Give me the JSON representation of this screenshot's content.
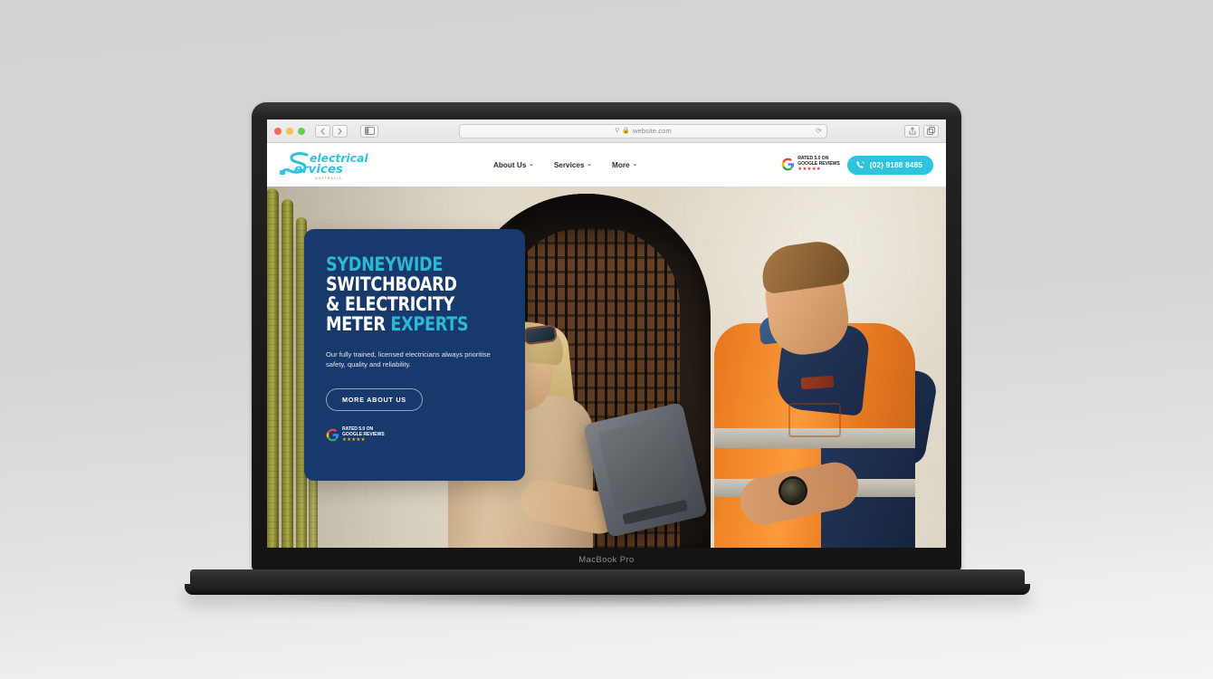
{
  "device": {
    "label": "MacBook Pro"
  },
  "browser": {
    "traffic_lights": [
      "close",
      "minimize",
      "maximize"
    ],
    "back_icon": "chevron-left-icon",
    "forward_icon": "chevron-right-icon",
    "sidebar_icon": "sidebar-toggle-icon",
    "search_icon": "search-icon",
    "lock_icon": "lock-icon",
    "url": "website.com",
    "reload_icon": "reload-icon",
    "share_icon": "share-icon",
    "tabs_icon": "tabs-icon"
  },
  "site": {
    "logo": {
      "word_a": "electrical",
      "word_b": "ervices",
      "initial": "S",
      "sub": "AUSTRALIA"
    },
    "nav": [
      {
        "label": "About Us",
        "caret": "⌄"
      },
      {
        "label": "Services",
        "caret": "⌄"
      },
      {
        "label": "More",
        "caret": "⌄"
      }
    ],
    "google_badge": {
      "line1": "RATED 5.0 ON",
      "line2": "GOOGLE REVIEWS",
      "stars": "★★★★★",
      "stars_color_header": "#e2342b",
      "stars_color_hero": "#f2b01e",
      "logo": "google-g-icon"
    },
    "phone": {
      "icon": "phone-icon",
      "number": "(02) 9188 8485",
      "bg": "#2ec4dd"
    }
  },
  "hero": {
    "headline_line1": "SYDNEYWIDE",
    "headline_line2": "SWITCHBOARD",
    "headline_line3": "& ELECTRICITY",
    "headline_line4a": "METER ",
    "headline_line4b": "EXPERTS",
    "body": "Our fully trained, licensed electricians always prioritise safety, quality and reliability.",
    "cta": "MORE ABOUT US",
    "card_bg": "#17396b",
    "accent": "#2bb8d4"
  }
}
